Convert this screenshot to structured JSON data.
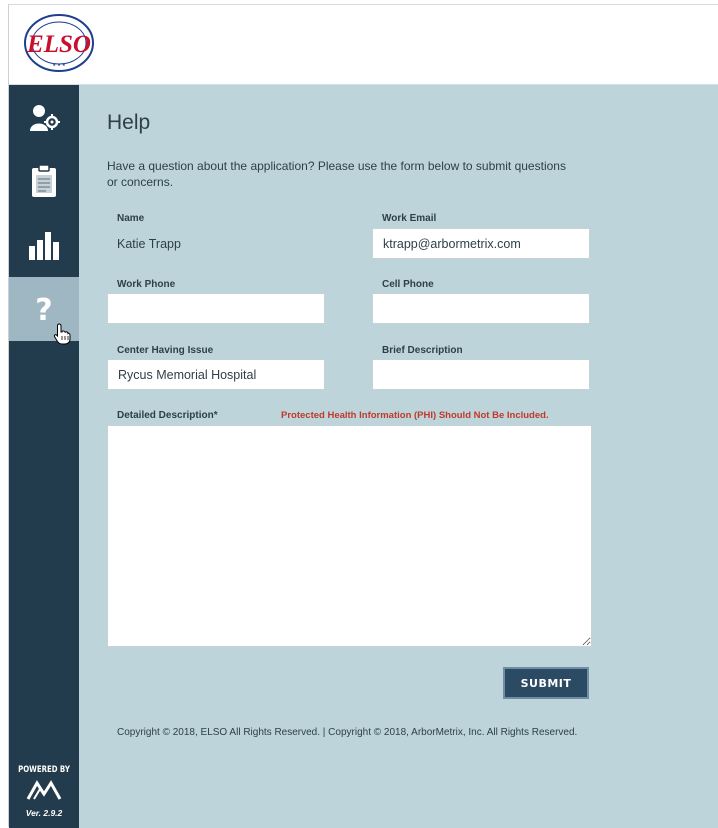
{
  "brand": {
    "logo_text": "ELSO"
  },
  "sidebar": {
    "items": [
      {
        "icon": "user-settings-icon"
      },
      {
        "icon": "clipboard-icon"
      },
      {
        "icon": "bar-chart-icon"
      },
      {
        "icon": "help-icon",
        "active": true
      }
    ],
    "powered_by": "POWERED BY",
    "version": "Ver. 2.9.2"
  },
  "page": {
    "title": "Help",
    "intro": "Have a question about the application? Please use the form below to submit questions or concerns."
  },
  "form": {
    "name_label": "Name",
    "name_value": "Katie Trapp",
    "work_email_label": "Work Email",
    "work_email_value": "ktrapp@arbormetrix.com",
    "work_phone_label": "Work Phone",
    "work_phone_value": "",
    "cell_phone_label": "Cell Phone",
    "cell_phone_value": "",
    "center_label": "Center Having Issue",
    "center_value": "Rycus Memorial Hospital",
    "brief_label": "Brief Description",
    "brief_value": "",
    "detailed_label": "Detailed Description*",
    "phi_warning": "Protected Health Information (PHI) Should Not Be Included.",
    "detailed_value": "",
    "submit_label": "SUBMIT"
  },
  "footer": {
    "copyright": "Copyright © 2018, ELSO All Rights Reserved. | Copyright © 2018, ArborMetrix, Inc. All Rights Reserved."
  },
  "colors": {
    "sidebar": "#223b4d",
    "content": "#bcd4da",
    "active_nav": "#9fb7c3",
    "submit": "#2b4a63",
    "warning": "#c0392b"
  }
}
